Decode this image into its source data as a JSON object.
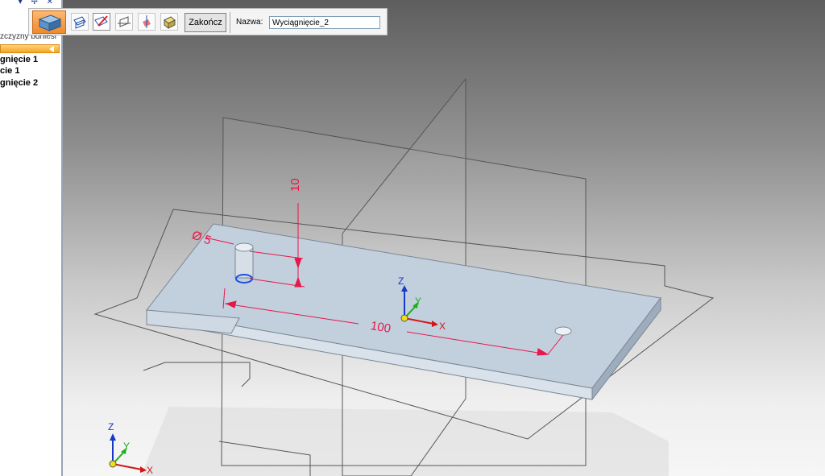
{
  "left_panel": {
    "header_controls": "▾ ✢ ✕",
    "subtitle": "zczyzny bdniesl",
    "items": [
      "gnięcie 1",
      "cie 1",
      "gnięcie 2"
    ]
  },
  "toolbar": {
    "finish_label": "Zakończ",
    "name_label": "Nazwa:",
    "name_value": "Wyciągnięcie_2",
    "icons": [
      "extrude-feature-icon",
      "plane-step-icon",
      "sketch-step-icon",
      "side-step-icon",
      "extent-step-icon",
      "treatment-step-icon"
    ]
  },
  "viewport": {
    "dimensions": {
      "diameter_label": "Ø 5",
      "height_label": "10",
      "length_label": "100"
    },
    "axes": {
      "x": "X",
      "y": "Y",
      "z": "Z"
    },
    "colors": {
      "dimension": "#e8174a",
      "axis_x": "#d01818",
      "axis_y": "#18b018",
      "axis_z": "#1838c8",
      "part": "#c2d0de"
    }
  }
}
